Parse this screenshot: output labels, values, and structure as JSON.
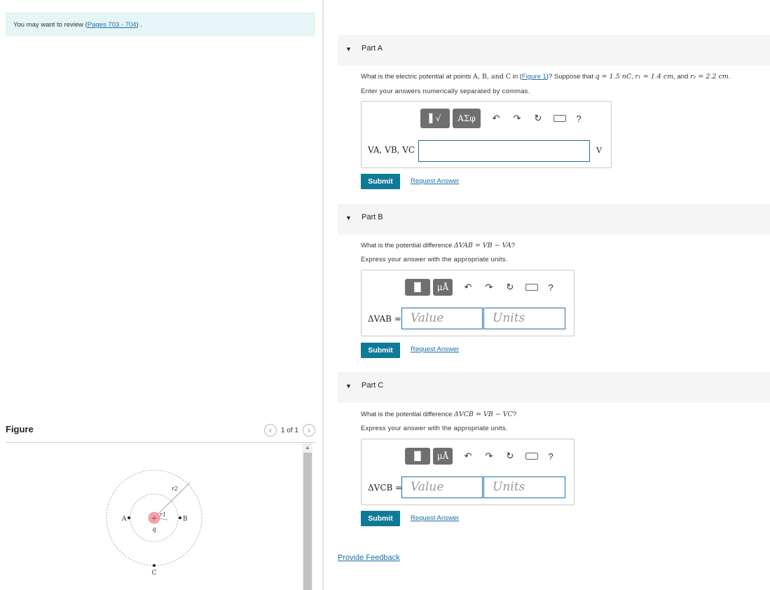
{
  "review": {
    "text": "You may want to review (",
    "link": "Pages 703 - 704",
    "suffix": ") ."
  },
  "figure": {
    "title": "Figure",
    "counter": "1 of 1",
    "labels": {
      "A": "A",
      "B": "B",
      "C": "C",
      "q": "q",
      "r1": "r1",
      "r2": "r2",
      "plus": "+"
    }
  },
  "parts": [
    {
      "title": "Part A",
      "question": {
        "pre": "What is the electric potential at points ",
        "points": "A, B, and C",
        "mid": " in (",
        "link": "Figure 1",
        "post": ")? Suppose that ",
        "q": "q = 1.5 nC",
        "r1": "r₁ = 1.4 cm",
        "and": ", and ",
        "r2": "r₂ = 2.2 cm",
        "end": "."
      },
      "instruction": "Enter your answers numerically separated by commas.",
      "toolbar": [
        "▌√",
        "ΑΣφ"
      ],
      "label": "VA, VB, VC =",
      "unit": "V",
      "submit": "Submit",
      "request": "Request Answer"
    },
    {
      "title": "Part B",
      "question": {
        "pre": "What is the potential difference ",
        "expr": "ΔVAB = VB − VA",
        "end": "?"
      },
      "instruction": "Express your answer with the appropriate units.",
      "toolbar": [
        "▐▌",
        "μÅ"
      ],
      "label": "ΔVAB =",
      "value_placeholder": "Value",
      "units_placeholder": "Units",
      "submit": "Submit",
      "request": "Request Answer"
    },
    {
      "title": "Part C",
      "question": {
        "pre": "What is the potential difference ",
        "expr": "ΔVCB = VB − VC",
        "end": "?"
      },
      "instruction": "Express your answer with the appropriate units.",
      "toolbar": [
        "▐▌",
        "μÅ"
      ],
      "label": "ΔVCB =",
      "value_placeholder": "Value",
      "units_placeholder": "Units",
      "submit": "Submit",
      "request": "Request Answer"
    }
  ],
  "tools": {
    "undo": "↶",
    "redo": "↷",
    "reset": "↻",
    "help": "?"
  },
  "feedback": "Provide Feedback",
  "colors": {
    "accent": "#0f7a96",
    "link": "#1a6fa8",
    "review_bg": "#e6f5f6",
    "charge": "#f4a3ab"
  }
}
